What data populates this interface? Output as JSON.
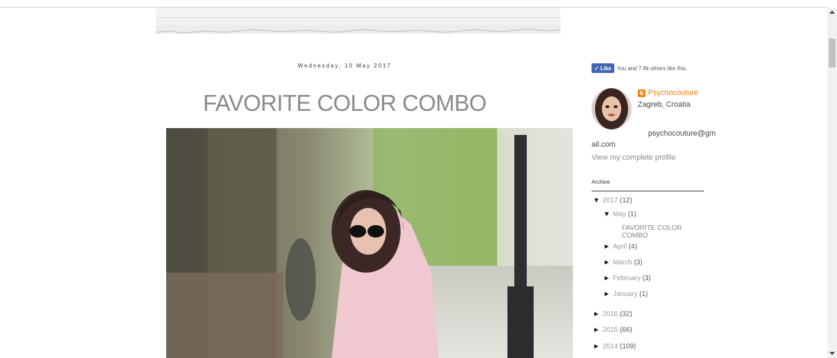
{
  "post": {
    "date": "Wednesday, 10 May 2017",
    "title": "FAVORITE COLOR COMBO",
    "photo_alt": "photo"
  },
  "sidebar": {
    "like": {
      "button_label": "Like",
      "text": "You and 7.9k others like this."
    },
    "profile": {
      "name": "Psychocouture",
      "location": "Zagreb, Croatia",
      "email_line1": "psychocouture@gm",
      "email_line2": "ail.com",
      "view_link": "View my complete profile"
    },
    "archive": {
      "title": "Archive",
      "years": [
        {
          "label": "2017",
          "count": "(12)",
          "expanded": true
        },
        {
          "label": "2016",
          "count": "(32)",
          "expanded": false
        },
        {
          "label": "2015",
          "count": "(66)",
          "expanded": false
        },
        {
          "label": "2014",
          "count": "(109)",
          "expanded": false
        }
      ],
      "months": [
        {
          "label": "May",
          "count": "(1)",
          "expanded": true
        },
        {
          "label": "April",
          "count": "(4)",
          "expanded": false
        },
        {
          "label": "March",
          "count": "(3)",
          "expanded": false
        },
        {
          "label": "February",
          "count": "(3)",
          "expanded": false
        },
        {
          "label": "January",
          "count": "(1)",
          "expanded": false
        }
      ],
      "posts": [
        "FAVORITE COLOR COMBO"
      ]
    }
  },
  "icons": {
    "expanded": "▼",
    "collapsed": "►",
    "like_check": "✓"
  },
  "colors": {
    "title": "#8a8a8a",
    "blogger_orange": "#f57d00",
    "facebook_blue": "#4267b2"
  }
}
